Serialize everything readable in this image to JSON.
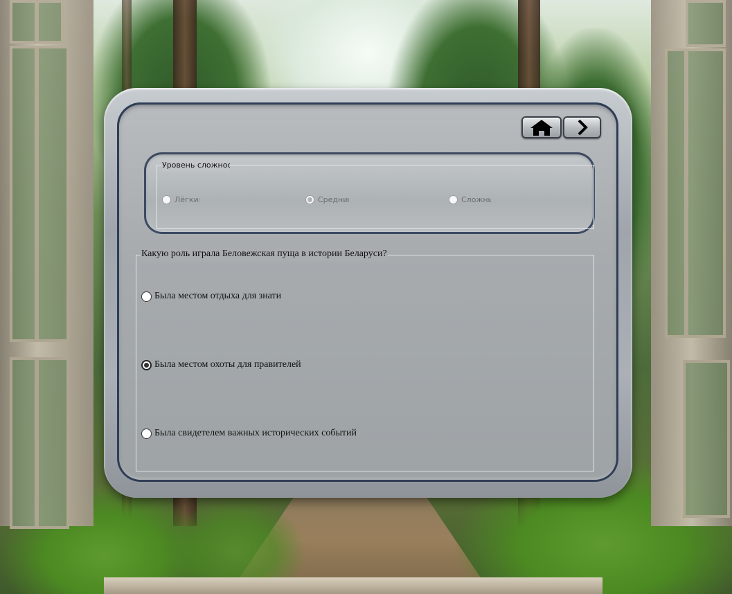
{
  "toolbar": {
    "home_icon": "home-icon",
    "next_icon": "chevron-right-icon"
  },
  "difficulty": {
    "legend": "Уровень сложнос",
    "options": [
      {
        "label": "Лёгкий",
        "selected": false
      },
      {
        "label": "Средний",
        "selected": true
      },
      {
        "label": "Сложный",
        "selected": false
      }
    ]
  },
  "question": {
    "text": "Какую роль играла Беловежская пуща в истории Беларуси?",
    "answers": [
      {
        "label": "Была местом отдыха для знати",
        "selected": false
      },
      {
        "label": "Была местом охоты для правителей",
        "selected": true
      },
      {
        "label": "Была свидетелем важных исторических событий",
        "selected": false
      }
    ]
  }
}
